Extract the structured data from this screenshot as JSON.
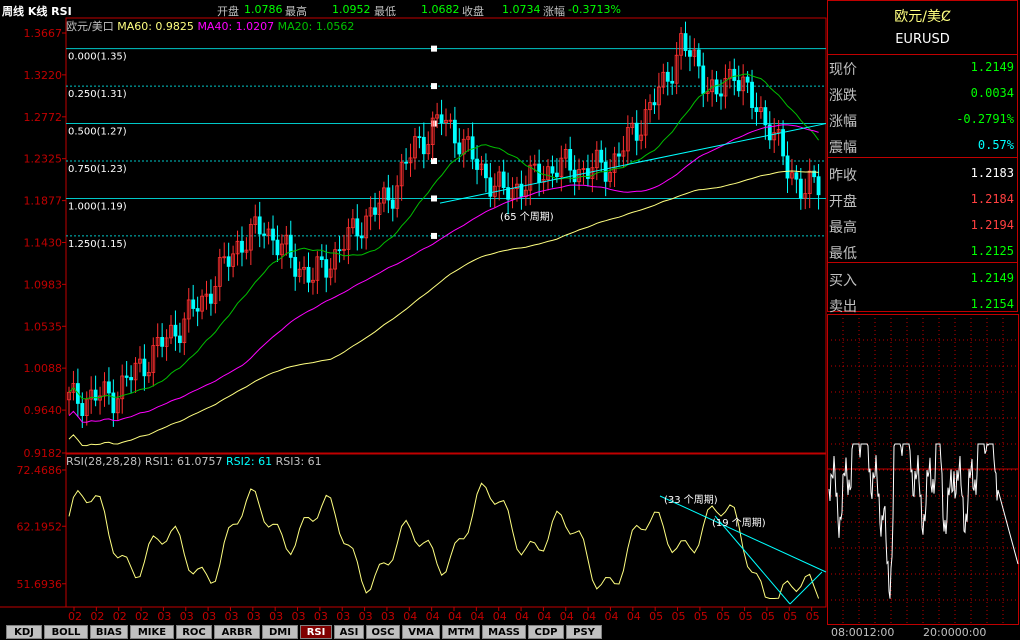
{
  "header": {
    "chart_label": "周线 K线 RSI",
    "open_label": "开盘",
    "open_value": "1.0786",
    "high_label": "最高",
    "high_value": "1.0952",
    "low_label": "最低",
    "low_value": "1.0682",
    "close_label": "收盘",
    "close_value": "1.0734",
    "change_label": "涨幅",
    "change_value": "-0.3713%"
  },
  "main_chart": {
    "legend_symbol": "欧元/美口",
    "ma60_label": "MA60: 0.9825",
    "ma40_label": "MA40: 1.0207",
    "ma20_label": "MA20: 1.0562",
    "y_ticks": [
      "1.3667",
      "1.3220",
      "1.2772",
      "1.2325",
      "1.1877",
      "1.1430",
      "1.0983",
      "1.0535",
      "1.0088",
      "0.9640",
      "0.9182"
    ],
    "fib_levels": [
      {
        "label": "0.000(1.35)",
        "value": 1.35
      },
      {
        "label": "0.250(1.31)",
        "value": 1.31
      },
      {
        "label": "0.500(1.27)",
        "value": 1.27
      },
      {
        "label": "0.750(1.23)",
        "value": 1.23
      },
      {
        "label": "1.000(1.19)",
        "value": 1.19
      },
      {
        "label": "1.250(1.15)",
        "value": 1.15
      }
    ],
    "annotation": "(65 个周期)",
    "colors": {
      "ma60": "#ffff80",
      "ma40": "#ff00ff",
      "ma20": "#00c000",
      "up": "#ff3030",
      "down": "#00ffff",
      "fib": "#00ffff"
    }
  },
  "rsi_chart": {
    "legend": "RSI(28,28,28) RSI1: 61.0757",
    "rsi2_label": "RSI2: 61",
    "rsi3_label": "RSI3: 61",
    "y_ticks": [
      "72.4686",
      "62.1952",
      "51.6936"
    ],
    "annotation_1": "(33 个周期)",
    "annotation_2": "(19 个周期)"
  },
  "x_axis": {
    "labels": [
      "02",
      "02",
      "02",
      "02",
      "03",
      "03",
      "03",
      "03",
      "03",
      "03",
      "03",
      "03",
      "03",
      "03",
      "03",
      "04",
      "04",
      "04",
      "04",
      "04",
      "04",
      "04",
      "04",
      "04",
      "04",
      "04",
      "05",
      "05",
      "05",
      "05",
      "05",
      "05",
      "05",
      "05"
    ]
  },
  "tabs": [
    "KDJ",
    "BOLL",
    "BIAS",
    "MIKE",
    "ROC",
    "ARBR",
    "DMI",
    "RSI",
    "ASI",
    "OSC",
    "VMA",
    "MTM",
    "MASS",
    "CDP",
    "PSY"
  ],
  "active_tab": "RSI",
  "quote_panel": {
    "title": "欧元/美Ȼ",
    "code": "EURUSD",
    "rows": [
      {
        "label": "现价",
        "value": "1.2149",
        "color": "#00ff00"
      },
      {
        "label": "涨跌",
        "value": "0.0034",
        "color": "#00ff00"
      },
      {
        "label": "涨幅",
        "value": "-0.2791%",
        "color": "#00ff00"
      },
      {
        "label": "震幅",
        "value": "0.57%",
        "color": "#00ffff"
      },
      {
        "label": "昨收",
        "value": "1.2183",
        "color": "#ffffff"
      },
      {
        "label": "开盘",
        "value": "1.2184",
        "color": "#ff4040"
      },
      {
        "label": "最高",
        "value": "1.2194",
        "color": "#ff4040"
      },
      {
        "label": "最低",
        "value": "1.2125",
        "color": "#00ff00"
      },
      {
        "label": "买入",
        "value": "1.2149",
        "color": "#00ff00"
      },
      {
        "label": "卖出",
        "value": "1.2154",
        "color": "#00ff00"
      }
    ],
    "tick_time_start": "08:0012:00",
    "tick_time_end": "20:0000:00"
  }
}
